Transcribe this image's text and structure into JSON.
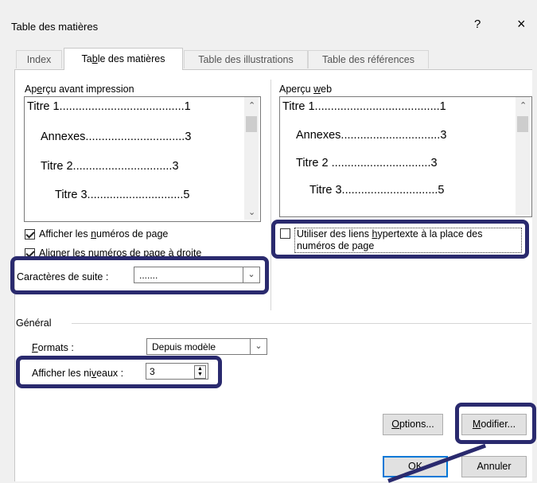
{
  "window": {
    "title": "Table des matières",
    "help_label": "?",
    "close_label": "×"
  },
  "tabs": [
    "Index",
    "Table des matières",
    "Table des illustrations",
    "Table des références"
  ],
  "print_preview": {
    "label": "Aperçu avant impression",
    "lines": [
      "Titre 1.......................................1",
      "Annexes...............................3",
      "Titre 2...............................3",
      "Titre 3..............................5"
    ]
  },
  "web_preview": {
    "label": "Aperçu web",
    "lines": [
      "Titre 1.......................................1",
      "Annexes...............................3",
      "Titre 2 ...............................3",
      "Titre 3..............................5"
    ]
  },
  "options": {
    "show_page_numbers": {
      "label": "Afficher les numéros de page",
      "checked": true
    },
    "align_right": {
      "label": "Aligner les numéros de page à droite",
      "checked": true
    },
    "use_hyperlinks": {
      "label": "Utiliser des liens hypertexte à la place des numéros de page",
      "checked": false
    }
  },
  "tab_leader": {
    "label": "Caractères de suite :",
    "value": "......."
  },
  "general": {
    "label": "Général",
    "formats_label": "Formats :",
    "formats_value": "Depuis modèle",
    "levels_label": "Afficher les niveaux :",
    "levels_value": "3"
  },
  "buttons": {
    "options": "Options...",
    "modify": "Modifier...",
    "ok": "OK",
    "cancel": "Annuler"
  },
  "colors": {
    "highlight": "#2a2a6e",
    "accent": "#0078d7"
  }
}
